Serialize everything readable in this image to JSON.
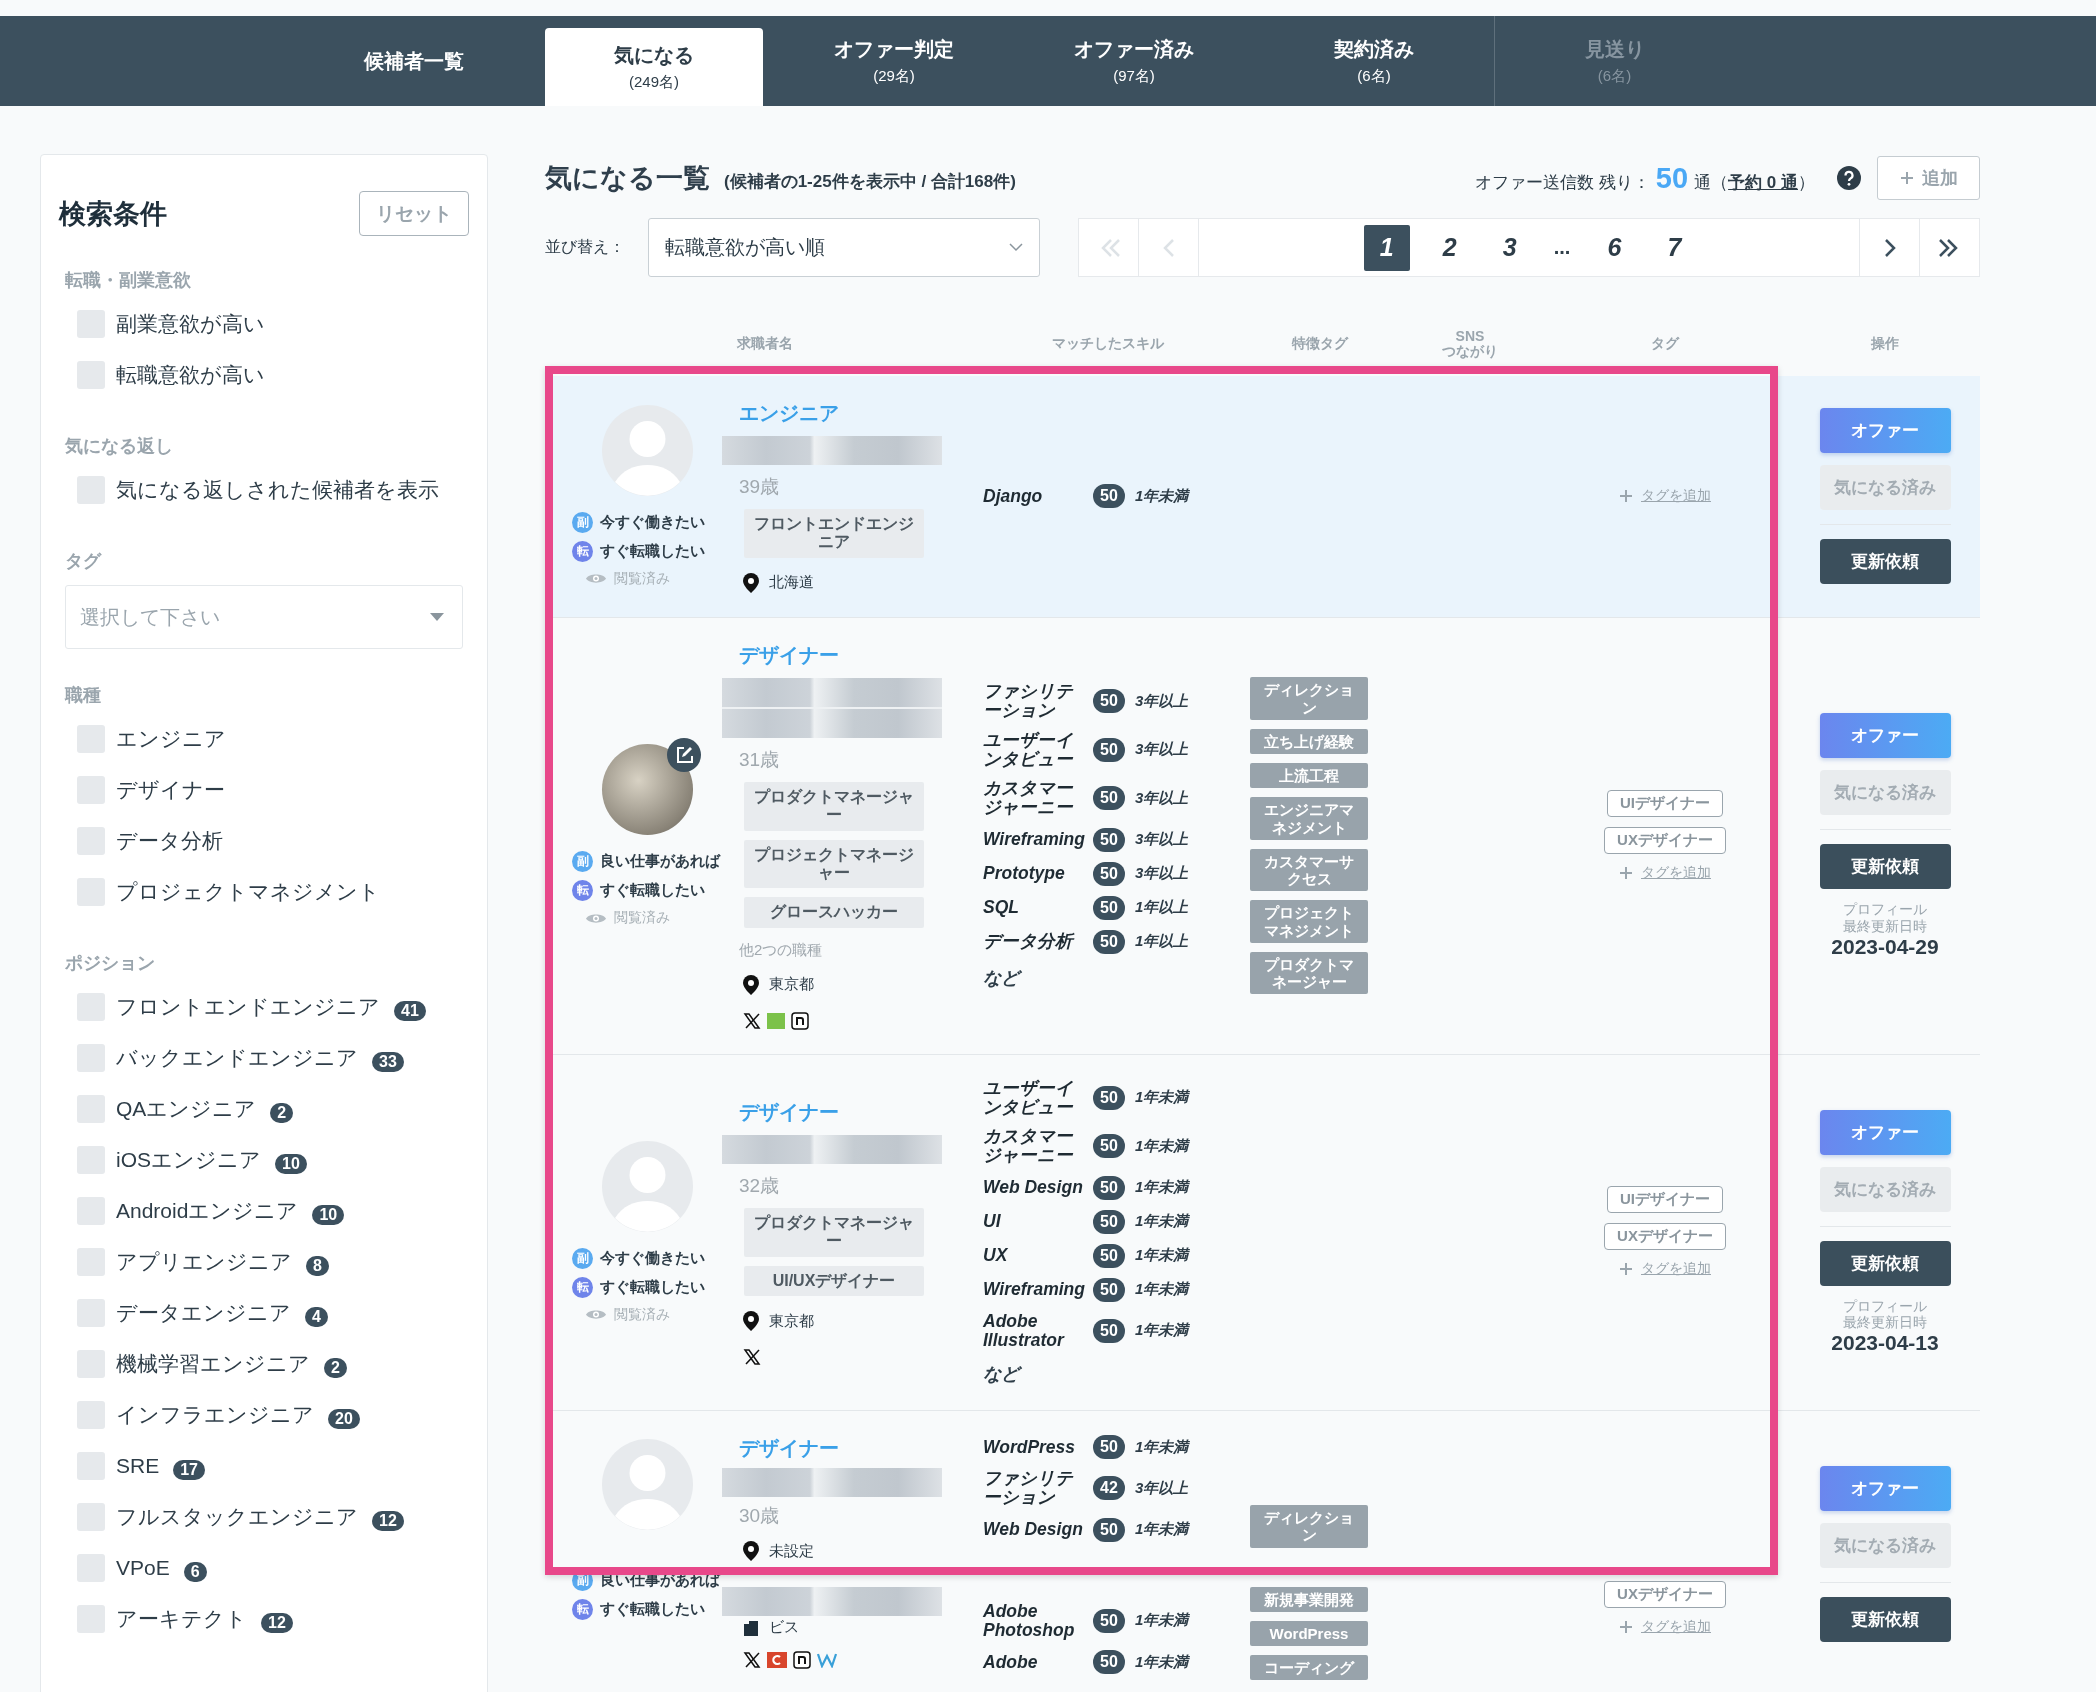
{
  "nav_tabs": [
    {
      "label": "候補者一覧",
      "selected": false,
      "disabled": false
    },
    {
      "label": "気になる",
      "count": "(249名)",
      "selected": true,
      "disabled": false
    },
    {
      "label": "オファー判定",
      "count": "(29名)",
      "selected": false,
      "disabled": false
    },
    {
      "label": "オファー済み",
      "count": "(97名)",
      "selected": false,
      "disabled": false
    },
    {
      "label": "契約済み",
      "count": "(6名)",
      "selected": false,
      "disabled": false
    },
    {
      "label": "見送り",
      "count": "(6名)",
      "selected": false,
      "disabled": true
    }
  ],
  "sidebar": {
    "title": "検索条件",
    "reset": "リセット",
    "sections": [
      {
        "kind": "checkboxes",
        "heading": "転職・副業意欲",
        "options": [
          {
            "label": "副業意欲が高い",
            "checked": false
          },
          {
            "label": "転職意欲が高い",
            "checked": false
          }
        ]
      },
      {
        "kind": "checkboxes",
        "heading": "気になる返し",
        "options": [
          {
            "label": "気になる返しされた候補者を表示",
            "checked": false
          }
        ]
      },
      {
        "kind": "select",
        "heading": "タグ",
        "placeholder": "選択して下さい"
      },
      {
        "kind": "checkboxes",
        "heading": "職種",
        "options": [
          {
            "label": "エンジニア",
            "checked": false
          },
          {
            "label": "デザイナー",
            "checked": false
          },
          {
            "label": "データ分析",
            "checked": false
          },
          {
            "label": "プロジェクトマネジメント",
            "checked": false
          }
        ]
      },
      {
        "kind": "checkboxes",
        "heading": "ポジション",
        "options": [
          {
            "label": "フロントエンドエンジニア",
            "count": "41",
            "checked": false
          },
          {
            "label": "バックエンドエンジニア",
            "count": "33",
            "checked": false
          },
          {
            "label": "QAエンジニア",
            "count": "2",
            "checked": false
          },
          {
            "label": "iOSエンジニア",
            "count": "10",
            "checked": false
          },
          {
            "label": "Androidエンジニア",
            "count": "10",
            "checked": false
          },
          {
            "label": "アプリエンジニア",
            "count": "8",
            "checked": false
          },
          {
            "label": "データエンジニア",
            "count": "4",
            "checked": false
          },
          {
            "label": "機械学習エンジニア",
            "count": "2",
            "checked": false
          },
          {
            "label": "インフラエンジニア",
            "count": "20",
            "checked": false
          },
          {
            "label": "SRE",
            "count": "17",
            "checked": false
          },
          {
            "label": "フルスタックエンジニア",
            "count": "12",
            "checked": false
          },
          {
            "label": "VPoE",
            "count": "6",
            "checked": false
          },
          {
            "label": "アーキテクト",
            "count": "12",
            "checked": false
          }
        ]
      }
    ]
  },
  "list": {
    "title": "気になる一覧",
    "summary": "(候補者の1-25件を表示中 / 合計168件)",
    "quota": {
      "label": "オファー送信数 残り：",
      "count": "50",
      "unit": "通",
      "open": "（",
      "reserved": "予約 0 通",
      "close": "）"
    },
    "add_button": "追加",
    "sort": {
      "label": "並び替え：",
      "value": "転職意欲が高い順"
    },
    "pagination": {
      "nav": [
        {
          "kind": "first",
          "disabled": true
        },
        {
          "kind": "prev",
          "disabled": true
        },
        {
          "kind": "next",
          "disabled": false
        },
        {
          "kind": "last",
          "disabled": false
        }
      ],
      "pages": [
        {
          "kind": "page",
          "label": "1",
          "selected": true
        },
        {
          "kind": "page",
          "label": "2",
          "selected": false
        },
        {
          "kind": "page",
          "label": "3",
          "selected": false
        },
        {
          "kind": "ellipsis",
          "label": "...",
          "selected": false
        },
        {
          "kind": "page",
          "label": "6",
          "selected": false
        },
        {
          "kind": "page",
          "label": "7",
          "selected": false
        }
      ]
    },
    "columns": [
      "求職者名",
      "マッチしたスキル",
      "特徴タグ",
      "SNS つながり",
      "タグ",
      "操作"
    ]
  },
  "candidates": [
    {
      "highlighted": true,
      "avatar": {
        "kind": "default"
      },
      "motivations": [
        {
          "kind": "side",
          "badge": "副",
          "label": "今すぐ働きたい"
        },
        {
          "kind": "change",
          "badge": "転",
          "label": "すぐ転職したい"
        }
      ],
      "viewed": "閲覧済み",
      "job": "エンジニア",
      "name_two_lines": false,
      "age": "39歳",
      "positions": [
        "フロントエンドエンジニア"
      ],
      "location": "北海道",
      "skills": [
        {
          "name": "Django",
          "score": "50",
          "years": "1年未満"
        }
      ],
      "add_tag": "タグを追加",
      "actions": {
        "offer": "オファー",
        "favorite": {
          "label": "気になる済み",
          "disabled": true
        },
        "update": "更新依頼"
      }
    },
    {
      "highlighted": false,
      "avatar": {
        "kind": "photo"
      },
      "motivations": [
        {
          "kind": "side",
          "badge": "副",
          "label": "良い仕事があれば"
        },
        {
          "kind": "change",
          "badge": "転",
          "label": "すぐ転職したい"
        }
      ],
      "viewed": "閲覧済み",
      "job": "デザイナー",
      "name_two_lines": true,
      "age": "31歳",
      "positions": [
        "プロダクトマネージャー",
        "プロジェクトマネージャー",
        "グロースハッカー"
      ],
      "other_positions": "他2つの職種",
      "location": "東京都",
      "sns": [
        {
          "kind": "x"
        },
        {
          "kind": "green"
        },
        {
          "kind": "note"
        }
      ],
      "skills": [
        {
          "name": "ファシリテーション",
          "score": "50",
          "years": "3年以上"
        },
        {
          "name": "ユーザーインタビュー",
          "score": "50",
          "years": "3年以上"
        },
        {
          "name": "カスタマージャーニー",
          "score": "50",
          "years": "3年以上"
        },
        {
          "name": "Wireframing",
          "score": "50",
          "years": "3年以上"
        },
        {
          "name": "Prototype",
          "score": "50",
          "years": "3年以上"
        },
        {
          "name": "SQL",
          "score": "50",
          "years": "1年以上"
        },
        {
          "name": "データ分析",
          "score": "50",
          "years": "1年以上"
        }
      ],
      "skills_more": "など",
      "feature_tags": [
        "ディレクション",
        "立ち上げ経験",
        "上流工程",
        "エンジニアマネジメント",
        "カスタマーサクセス",
        "プロジェクトマネジメント",
        "プロダクトマネージャー"
      ],
      "tags": [
        "UIデザイナー",
        "UXデザイナー"
      ],
      "add_tag": "タグを追加",
      "actions": {
        "offer": "オファー",
        "favorite": {
          "label": "気になる済み",
          "disabled": true
        },
        "update": "更新依頼",
        "updated_label": "プロフィール最終更新日時",
        "updated_date": "2023-04-29"
      }
    },
    {
      "highlighted": false,
      "avatar": {
        "kind": "default"
      },
      "motivations": [
        {
          "kind": "side",
          "badge": "副",
          "label": "今すぐ働きたい"
        },
        {
          "kind": "change",
          "badge": "転",
          "label": "すぐ転職したい"
        }
      ],
      "viewed": "閲覧済み",
      "job": "デザイナー",
      "name_two_lines": false,
      "age": "32歳",
      "positions": [
        "プロダクトマネージャー",
        "UI/UXデザイナー"
      ],
      "location": "東京都",
      "sns": [
        {
          "kind": "x"
        }
      ],
      "skills": [
        {
          "name": "ユーザーインタビュー",
          "score": "50",
          "years": "1年未満"
        },
        {
          "name": "カスタマージャーニー",
          "score": "50",
          "years": "1年未満"
        },
        {
          "name": "Web Design",
          "score": "50",
          "years": "1年未満"
        },
        {
          "name": "UI",
          "score": "50",
          "years": "1年未満"
        },
        {
          "name": "UX",
          "score": "50",
          "years": "1年未満"
        },
        {
          "name": "Wireframing",
          "score": "50",
          "years": "1年未満"
        },
        {
          "name": "Adobe Illustrator",
          "score": "50",
          "years": "1年未満"
        }
      ],
      "skills_more": "など",
      "tags": [
        "UIデザイナー",
        "UXデザイナー"
      ],
      "add_tag": "タグを追加",
      "actions": {
        "offer": "オファー",
        "favorite": {
          "label": "気になる済み",
          "disabled": true
        },
        "update": "更新依頼",
        "updated_label": "プロフィール最終更新日時",
        "updated_date": "2023-04-13"
      }
    },
    {
      "highlighted": false,
      "avatar": {
        "kind": "default"
      },
      "motivations": [
        {
          "kind": "side",
          "badge": "副",
          "label": "良い仕事があれば"
        },
        {
          "kind": "change",
          "badge": "転",
          "label": "すぐ転職したい"
        }
      ],
      "job": "デザイナー",
      "name_two_lines": false,
      "age": "30歳",
      "location": "未設定",
      "company": "ビス",
      "sns": [
        {
          "kind": "x"
        },
        {
          "kind": "red"
        },
        {
          "kind": "note"
        },
        {
          "kind": "w"
        }
      ],
      "skills": [
        {
          "name": "WordPress",
          "score": "50",
          "years": "1年未満"
        },
        {
          "name": "ファシリテーション",
          "score": "42",
          "years": "3年以上"
        },
        {
          "name": "Web Design",
          "score": "50",
          "years": "1年未満"
        },
        {
          "name": "Adobe Photoshop",
          "score": "50",
          "years": "1年未満"
        },
        {
          "name": "Adobe",
          "score": "50",
          "years": "1年未満"
        }
      ],
      "feature_tags": [
        "ディレクション",
        "新規事業開発",
        "WordPress",
        "コーディング"
      ],
      "tags": [
        "UXデザイナー"
      ],
      "add_tag": "タグを追加",
      "actions": {
        "offer": "オファー",
        "favorite": {
          "label": "気になる済み",
          "disabled": true
        },
        "update": "更新依頼"
      }
    }
  ]
}
